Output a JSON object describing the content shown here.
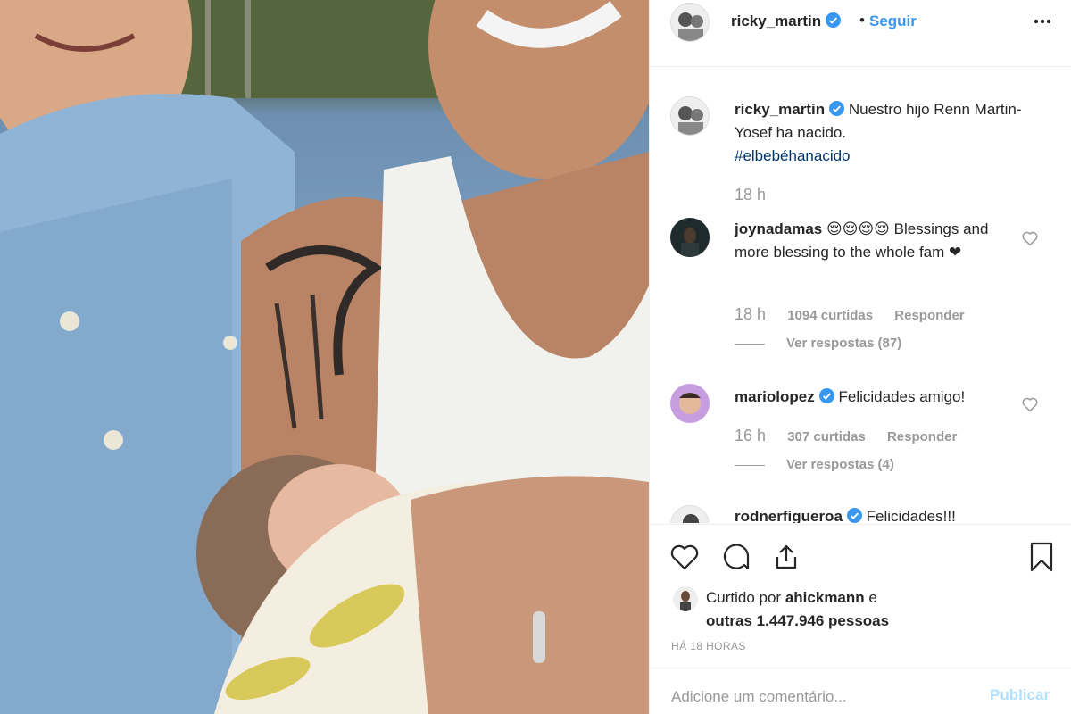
{
  "post": {
    "author": "ricky_martin",
    "follow_label": "Seguir",
    "separator": "•",
    "caption": {
      "username": "ricky_martin",
      "text": "Nuestro hijo Renn Martin-Yosef ha nacido.",
      "hashtag": "#elbebéhanacido",
      "time": "18 h"
    },
    "comments": [
      {
        "username": "joynadamas",
        "text": "😌😌😌😌 Blessings and more blessing to the whole fam ❤",
        "time": "18 h",
        "likes": "1094 curtidas",
        "reply": "Responder",
        "view_replies": "Ver respostas (87)"
      },
      {
        "username": "mariolopez",
        "text": "Felicidades amigo!",
        "time": "16 h",
        "likes": "307 curtidas",
        "reply": "Responder",
        "view_replies": "Ver respostas (4)"
      },
      {
        "username": "rodnerfigueroa",
        "text": "Felicidades!!!"
      }
    ],
    "liked_by": {
      "prefix": "Curtido por",
      "user": "ahickmann",
      "conjunction": "e",
      "others": "outras 1.447.946 pessoas"
    },
    "posted_ago": "HÁ 18 HORAS",
    "comment_input": {
      "placeholder": "Adicione um comentário..."
    },
    "publish_label": "Publicar"
  },
  "icons": {
    "more": "more-options-icon",
    "verified": "verified-badge-icon",
    "like": "heart-icon",
    "comment": "comment-icon",
    "share": "share-icon",
    "save": "bookmark-icon"
  },
  "colors": {
    "link": "#3897f0",
    "verified": "#3897f0",
    "muted": "#999999",
    "publish_disabled": "#b2dffc"
  }
}
